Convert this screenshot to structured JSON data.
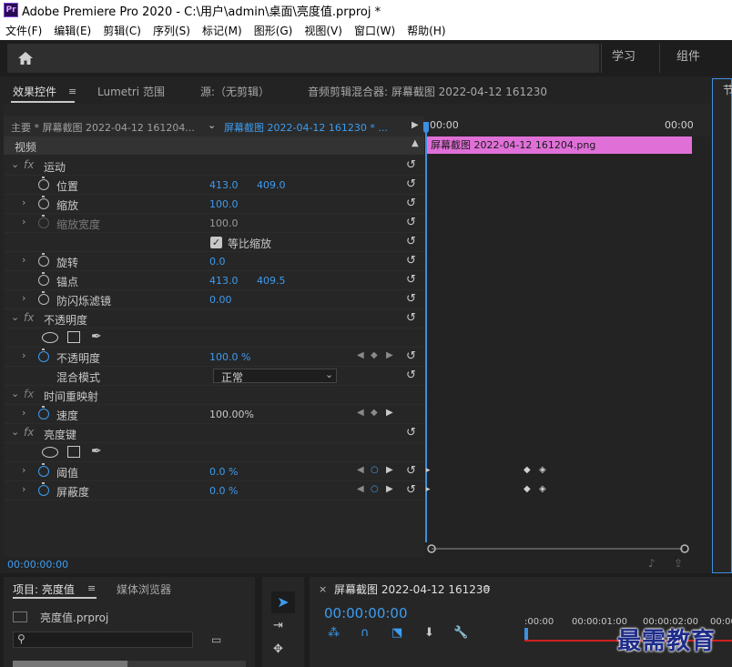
{
  "window": {
    "title": "Adobe Premiere Pro 2020 - C:\\用户\\admin\\桌面\\亮度值.prproj *",
    "app_icon": "Pr"
  },
  "menu": [
    "文件(F)",
    "编辑(E)",
    "剪辑(C)",
    "序列(S)",
    "标记(M)",
    "图形(G)",
    "视图(V)",
    "窗口(W)",
    "帮助(H)"
  ],
  "workspaces": {
    "learn": "学习",
    "assemble": "组件"
  },
  "panel_tabs": {
    "effect_controls": "效果控件",
    "lumetri": "Lumetri 范围",
    "source": "源:（无剪辑）",
    "audio_mixer": "音频剪辑混合器: 屏幕截图 2022-04-12 161230"
  },
  "ec": {
    "master_clip": "主要 * 屏幕截图 2022-04-12 161204...",
    "sequence_clip": "屏幕截图 2022-04-12 161230 * ...",
    "video_section": "视频",
    "timecode_start": "00:00",
    "timecode_end": "00:00",
    "clip_name": "屏幕截图 2022-04-12  161204.png",
    "current_time": "00:00:00:00"
  },
  "motion": {
    "title": "运动",
    "position": {
      "label": "位置",
      "x": "413.0",
      "y": "409.0"
    },
    "scale": {
      "label": "缩放",
      "value": "100.0"
    },
    "scale_width": {
      "label": "缩放宽度",
      "value": "100.0"
    },
    "uniform_scale": "等比缩放",
    "rotation": {
      "label": "旋转",
      "value": "0.0"
    },
    "anchor": {
      "label": "锚点",
      "x": "413.0",
      "y": "409.5"
    },
    "antiflicker": {
      "label": "防闪烁滤镜",
      "value": "0.00"
    }
  },
  "opacity": {
    "title": "不透明度",
    "opacity": {
      "label": "不透明度",
      "value": "100.0 %"
    },
    "blend_mode": {
      "label": "混合模式",
      "value": "正常"
    }
  },
  "time_remap": {
    "title": "时间重映射",
    "speed": {
      "label": "速度",
      "value": "100.00%"
    }
  },
  "luma_key": {
    "title": "亮度键",
    "threshold": {
      "label": "阈值",
      "value": "0.0 %"
    },
    "cutoff": {
      "label": "屏蔽度",
      "value": "0.0 %"
    }
  },
  "project": {
    "tab": "项目: 亮度值",
    "media_browser": "媒体浏览器",
    "file": "亮度值.prproj"
  },
  "sequence": {
    "tab": "屏幕截图 2022-04-12 161230",
    "timecode": "00:00:00:00",
    "ruler": [
      ":00:00",
      "00:00:01:00",
      "00:00:02:00",
      "00:00"
    ]
  },
  "watermark": "最需教育",
  "colors": {
    "accent": "#3d9cf0",
    "clip": "#e070d8",
    "panel": "#262626"
  }
}
